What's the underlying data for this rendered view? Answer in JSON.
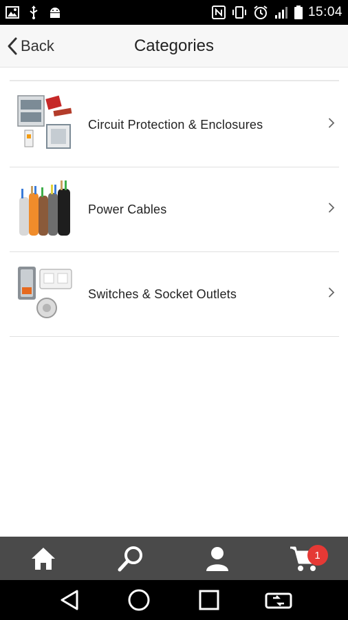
{
  "status_bar": {
    "time": "15:04",
    "icons_left": [
      "image-icon",
      "usb-icon",
      "android-icon"
    ],
    "icons_right": [
      "nfc-icon",
      "vibrate-icon",
      "alarm-icon",
      "signal-icon",
      "battery-icon"
    ]
  },
  "header": {
    "back_label": "Back",
    "title": "Categories"
  },
  "categories": [
    {
      "label": "Circuit Protection & Enclosures",
      "icon": "circuit-protection-thumbnail"
    },
    {
      "label": "Power Cables",
      "icon": "power-cables-thumbnail"
    },
    {
      "label": "Switches & Socket Outlets",
      "icon": "switches-sockets-thumbnail"
    }
  ],
  "tab_bar": {
    "tabs": [
      "home-icon",
      "search-icon",
      "account-icon",
      "cart-icon"
    ],
    "cart_count": "1"
  },
  "nav_bar": {
    "buttons": [
      "back-triangle-icon",
      "home-circle-icon",
      "recents-square-icon",
      "switch-app-icon"
    ]
  },
  "colors": {
    "header_bg": "#f7f7f7",
    "tab_bar_bg": "#4a4a4a",
    "badge": "#e53935"
  }
}
